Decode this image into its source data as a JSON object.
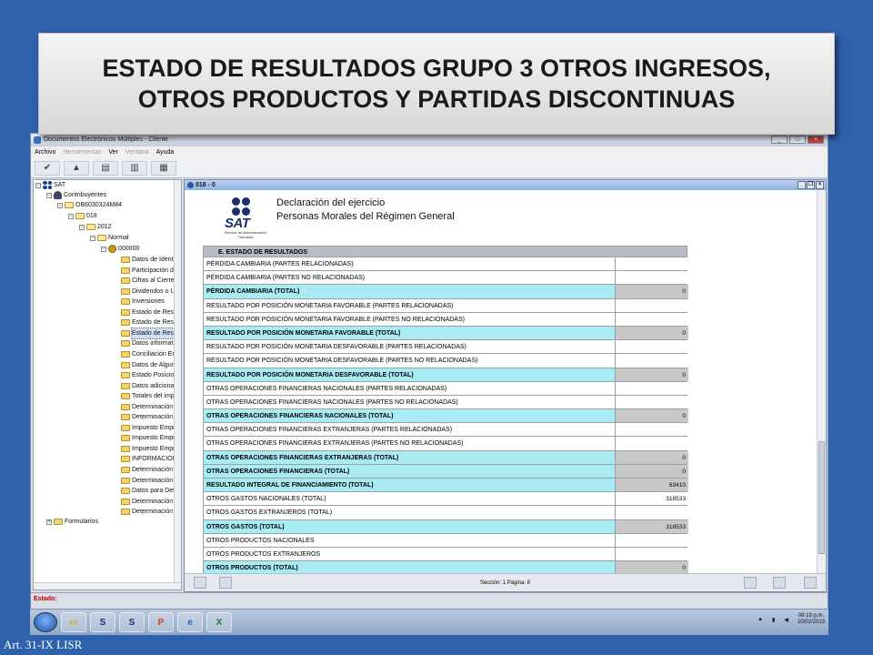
{
  "banner_title": "ESTADO DE RESULTADOS GRUPO 3 OTROS INGRESOS, OTROS PRODUCTOS Y PARTIDAS DISCONTINUAS",
  "window": {
    "title": "Documentos Electrónicos Múltiples - Cliente"
  },
  "menu": [
    {
      "label": "Archivo",
      "enabled": true
    },
    {
      "label": "Herramientas",
      "enabled": false
    },
    {
      "label": "Ver",
      "enabled": true
    },
    {
      "label": "Ventana",
      "enabled": false
    },
    {
      "label": "Ayuda",
      "enabled": true
    }
  ],
  "tree": {
    "root": "SAT",
    "contribuyentes": "Contribuyentes",
    "rfc": "OB6030324M84",
    "form": "018",
    "year": "2012",
    "tipo": "Normal",
    "doc": "000000",
    "items": [
      "Datos de Identif",
      "Participación de",
      "Cifras al Cierre",
      "Dividendos o Ut",
      "Inversiones",
      "Estado de Resu",
      "Estado de Resu",
      "Estado de Resu",
      "Datos informati",
      "Conciliación En",
      "Datos de Alguna",
      "Estado Posicion",
      "Datos adicional",
      "Totales del impu",
      "Determinación c",
      "Determinación c",
      "Impuesto Empre",
      "Impuesto Empre",
      "Impuesto Empre",
      "INFORMACION",
      "Determinación c",
      "Determinación c",
      "Datos para Dete",
      "Determinación c",
      "Determinación c"
    ],
    "selected_index": 7,
    "formularios": "Formularios"
  },
  "document": {
    "title": "018 - 0",
    "logo_text": "SAT",
    "logo_sub": "Servicio de Administración Tributaria",
    "heading1": "Declaración del ejercicio",
    "heading2": "Personas Morales del Régimen General",
    "section": "E. ESTADO DE RESULTADOS",
    "rows": [
      {
        "label": "PÉRDIDA CAMBIARIA (PARTES RELACIONADAS)",
        "value": "",
        "total": false
      },
      {
        "label": "PÉRDIDA CAMBIARIA (PARTES NO RELACIONADAS)",
        "value": "",
        "total": false
      },
      {
        "label": "PÉRDIDA CAMBIARIA (TOTAL)",
        "value": "0",
        "total": true
      },
      {
        "label": "RESULTADO POR POSICIÓN MONETARIA FAVORABLE (PARTES RELACIONADAS)",
        "value": "",
        "total": false
      },
      {
        "label": "RESULTADO POR POSICIÓN MONETARIA FAVORABLE (PARTES NO RELACIONADAS)",
        "value": "",
        "total": false
      },
      {
        "label": "RESULTADO POR POSICIÓN MONETARIA FAVORABLE (TOTAL)",
        "value": "0",
        "total": true
      },
      {
        "label": "RESULTADO POR POSICIÓN MONETARIA DESFAVORABLE (PARTES RELACIONADAS)",
        "value": "",
        "total": false
      },
      {
        "label": "RESULTADO POR POSICIÓN MONETARIA DESFAVORABLE (PARTES NO RELACIONADAS)",
        "value": "",
        "total": false
      },
      {
        "label": "RESULTADO POR POSICIÓN MONETARIA DESFAVORABLE (TOTAL)",
        "value": "0",
        "total": true
      },
      {
        "label": "OTRAS OPERACIONES FINANCIERAS NACIONALES (PARTES RELACIONADAS)",
        "value": "",
        "total": false
      },
      {
        "label": "OTRAS OPERACIONES FINANCIERAS NACIONALES (PARTES NO RELACIONADAS)",
        "value": "",
        "total": false
      },
      {
        "label": "OTRAS OPERACIONES FINANCIERAS NACIONALES (TOTAL)",
        "value": "0",
        "total": true
      },
      {
        "label": "OTRAS OPERACIONES FINANCIERAS EXTRANJERAS (PARTES RELACIONADAS)",
        "value": "",
        "total": false
      },
      {
        "label": "OTRAS OPERACIONES FINANCIERAS EXTRANJERAS (PARTES NO RELACIONADAS)",
        "value": "",
        "total": false
      },
      {
        "label": "OTRAS OPERACIONES FINANCIERAS EXTRANJERAS (TOTAL)",
        "value": "0",
        "total": true
      },
      {
        "label": "OTRAS OPERACIONES FINANCIERAS (TOTAL)",
        "value": "0",
        "total": true
      },
      {
        "label": "RESULTADO INTEGRAL DE FINANCIAMIENTO (TOTAL)",
        "value": "63410",
        "total": true
      },
      {
        "label": "OTROS GASTOS NACIONALES (TOTAL)",
        "value": "318533",
        "total": false
      },
      {
        "label": "OTROS GASTOS EXTRANJEROS (TOTAL)",
        "value": "",
        "total": false
      },
      {
        "label": "OTROS GASTOS (TOTAL)",
        "value": "318533",
        "total": true
      },
      {
        "label": "OTROS PRODUCTOS NACIONALES",
        "value": "",
        "total": false
      },
      {
        "label": "OTROS PRODUCTOS EXTRANJEROS",
        "value": "",
        "total": false
      },
      {
        "label": "OTROS PRODUCTOS (TOTAL)",
        "value": "0",
        "total": true
      }
    ],
    "status": "Sección: 1 Página: 8"
  },
  "estado_label": "Estado:",
  "taskbar": {
    "clock_time": "08:19 p.m.",
    "clock_date": "10/02/2013",
    "apps": [
      "explorer-icon",
      "sua-icon",
      "sat-icon",
      "powerpoint-icon",
      "ie-icon",
      "excel-icon"
    ]
  },
  "footer": "Art. 31-IX LISR"
}
